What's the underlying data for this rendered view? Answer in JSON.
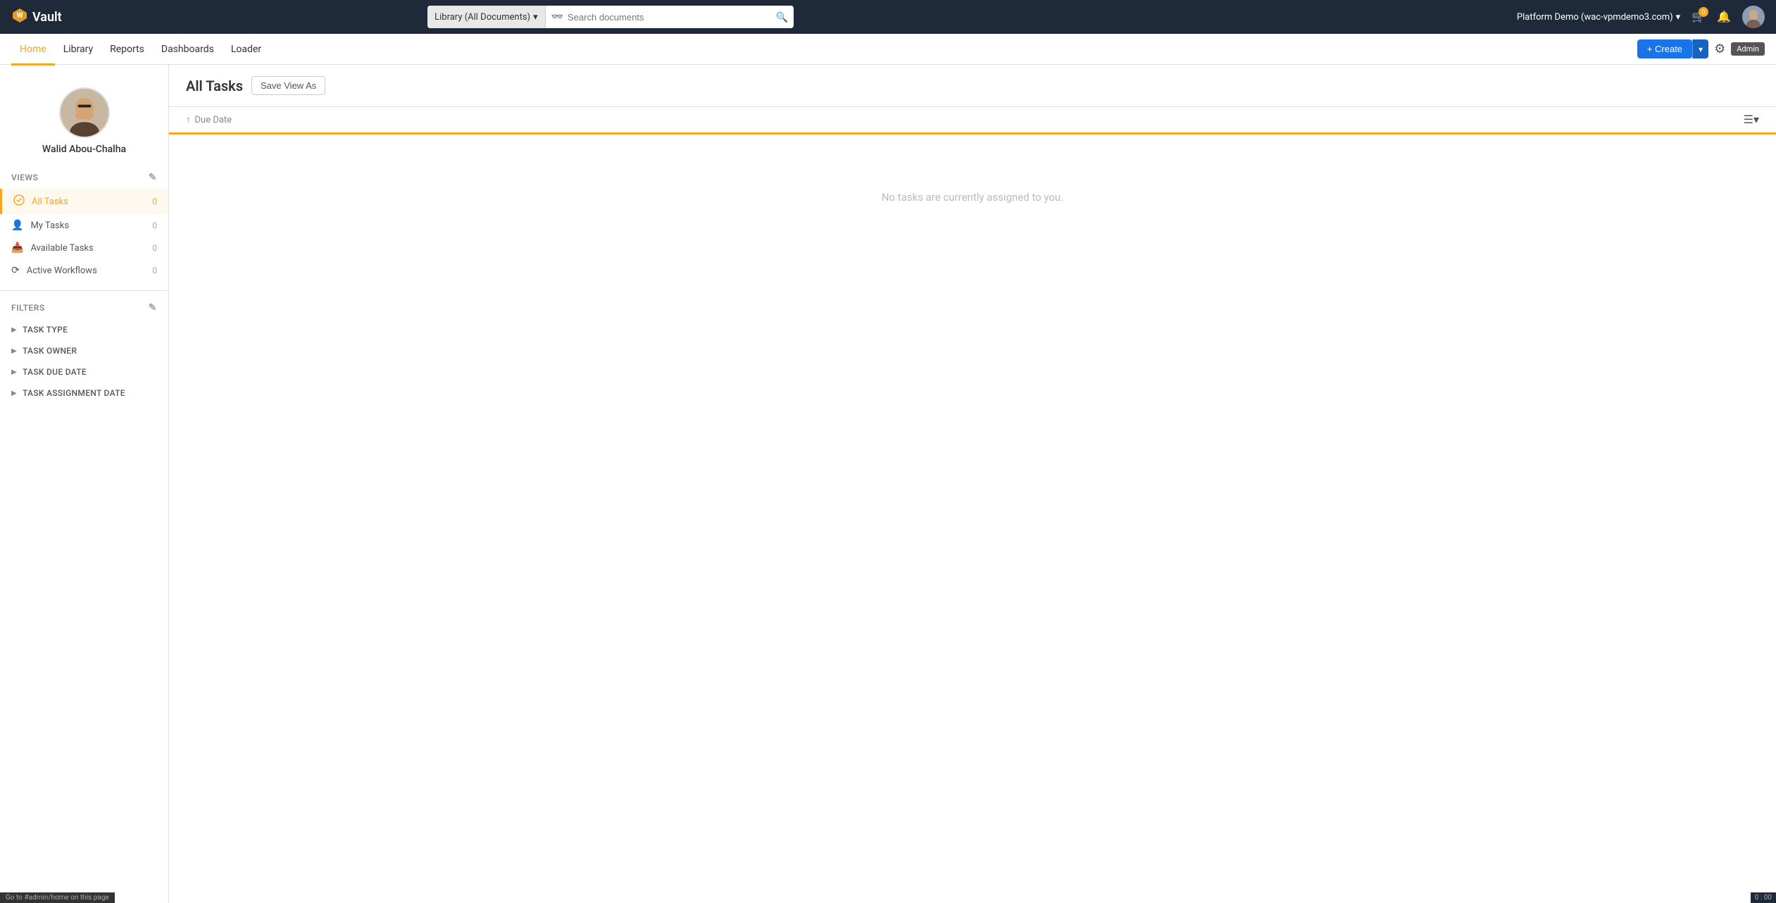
{
  "brand": {
    "logo_icon": "W",
    "name": "Vault"
  },
  "search": {
    "library_label": "Library (All Documents)",
    "placeholder": "Search documents",
    "dropdown_icon": "▾"
  },
  "navbar": {
    "platform_label": "Platform Demo (wac-vpmdemo3.com)",
    "cart_count": "0",
    "bell_icon": "🔔",
    "settings_icon": "⚙"
  },
  "tabs": [
    {
      "id": "home",
      "label": "Home",
      "active": true
    },
    {
      "id": "library",
      "label": "Library",
      "active": false
    },
    {
      "id": "reports",
      "label": "Reports",
      "active": false
    },
    {
      "id": "dashboards",
      "label": "Dashboards",
      "active": false
    },
    {
      "id": "loader",
      "label": "Loader",
      "active": false
    }
  ],
  "toolbar": {
    "create_label": "+ Create",
    "admin_label": "Admin"
  },
  "sidebar": {
    "profile": {
      "name": "Walid Abou-Chalha"
    },
    "views_section": {
      "label": "VIEWS",
      "items": [
        {
          "id": "all-tasks",
          "label": "All Tasks",
          "count": "0",
          "active": true
        },
        {
          "id": "my-tasks",
          "label": "My Tasks",
          "count": "0",
          "active": false
        },
        {
          "id": "available-tasks",
          "label": "Available Tasks",
          "count": "0",
          "active": false
        },
        {
          "id": "active-workflows",
          "label": "Active Workflows",
          "count": "0",
          "active": false
        }
      ]
    },
    "filters_section": {
      "label": "FILTERS",
      "items": [
        {
          "id": "task-type",
          "label": "TASK TYPE"
        },
        {
          "id": "task-owner",
          "label": "TASK OWNER"
        },
        {
          "id": "task-due-date",
          "label": "TASK DUE DATE"
        },
        {
          "id": "task-assignment-date",
          "label": "TASK ASSIGNMENT DATE"
        }
      ]
    }
  },
  "content": {
    "page_title": "All Tasks",
    "save_view_label": "Save View As",
    "sort_label": "Due Date",
    "empty_message": "No tasks are currently assigned to you."
  },
  "status_bar": {
    "link_text": "Go to #admin/home on this page"
  },
  "version": "0 : 00"
}
